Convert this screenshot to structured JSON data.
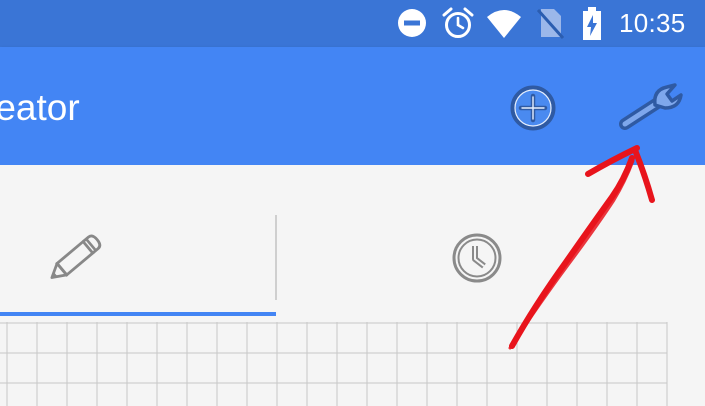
{
  "status_bar": {
    "time": "10:35",
    "icons": [
      "do-not-disturb-icon",
      "alarm-clock-icon",
      "wifi-icon",
      "no-sim-icon",
      "battery-charging-icon"
    ]
  },
  "app_bar": {
    "title": "reator",
    "actions": [
      "add-circle-icon",
      "wrench-icon"
    ]
  },
  "tabs": [
    {
      "icon": "pencil-icon",
      "selected": true
    },
    {
      "icon": "clock-icon",
      "selected": false
    }
  ],
  "colors": {
    "status_bar": "#3a75d6",
    "app_bar": "#4385f4",
    "tab_indicator": "#4385f4",
    "annotation_arrow": "#e8141c"
  }
}
